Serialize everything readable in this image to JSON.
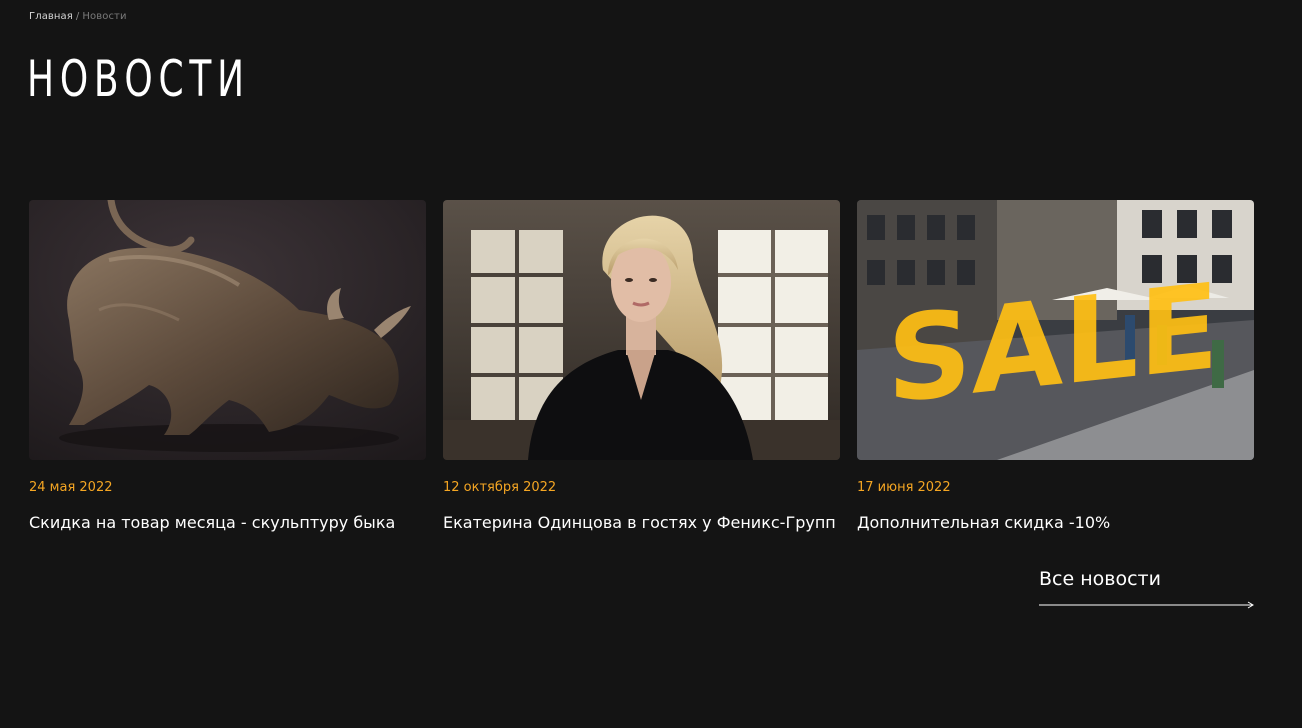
{
  "breadcrumb": {
    "home": "Главная",
    "separator": "/",
    "current": "Новости"
  },
  "page_title": "НОВОСТИ",
  "news": [
    {
      "date": "24 мая 2022",
      "title": "Скидка на товар месяца - скульптуру быка",
      "image": "bull-sculpture-image"
    },
    {
      "date": "12 октября 2022",
      "title": "Екатерина Одинцова в гостях у Феникс-Групп",
      "image": "woman-portrait-image"
    },
    {
      "date": "17 июня 2022",
      "title": "Дополнительная скидка -10%",
      "image": "sale-street-image",
      "image_text": "SALE"
    }
  ],
  "all_news": {
    "label": "Все новости",
    "icon": "arrow-right-icon"
  },
  "colors": {
    "background": "#141414",
    "accent": "#f5a623",
    "text": "#ffffff"
  }
}
